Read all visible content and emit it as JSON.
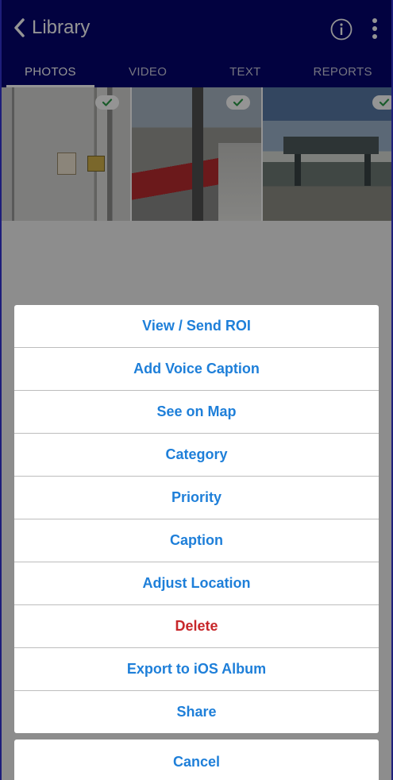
{
  "header": {
    "back_label": "Library",
    "info_icon": "info-circle-icon",
    "more_icon": "more-vertical-icon"
  },
  "tabs": [
    {
      "label": "PHOTOS",
      "active": true
    },
    {
      "label": "VIDEO",
      "active": false
    },
    {
      "label": "TEXT",
      "active": false
    },
    {
      "label": "REPORTS",
      "active": false
    }
  ],
  "photos": [
    {
      "selected": true
    },
    {
      "selected": true
    },
    {
      "selected": true
    }
  ],
  "action_sheet": {
    "items": [
      {
        "label": "View / Send ROI"
      },
      {
        "label": "Add Voice Caption"
      },
      {
        "label": "See on Map"
      },
      {
        "label": "Category"
      },
      {
        "label": "Priority"
      },
      {
        "label": "Caption"
      },
      {
        "label": "Adjust Location"
      },
      {
        "label": "Delete",
        "destructive": true
      },
      {
        "label": "Export to iOS Album"
      },
      {
        "label": "Share"
      }
    ],
    "cancel_label": "Cancel"
  },
  "colors": {
    "nav_background": "#04046e",
    "action_text": "#1e7fd9",
    "destructive_text": "#c7272a",
    "check_green": "#2e9e4a"
  }
}
